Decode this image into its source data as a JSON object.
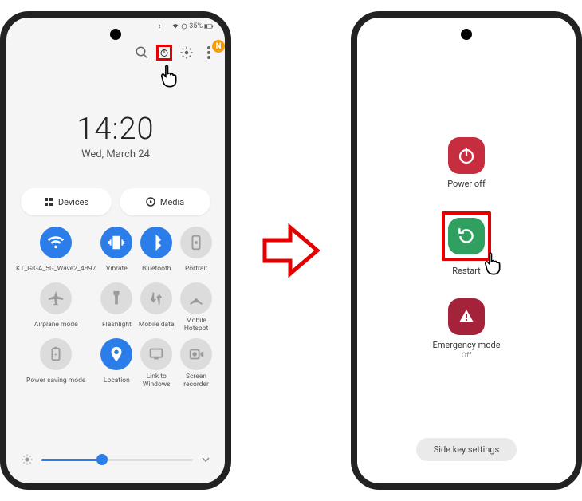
{
  "status": {
    "battery": "35%",
    "icons": "✱ ✕"
  },
  "clock": {
    "time": "14:20",
    "date": "Wed, March 24"
  },
  "dm": {
    "devices": "Devices",
    "media": "Media"
  },
  "qs": [
    {
      "label": "KT_GiGA_5G_Wave2_4B97",
      "on": true,
      "icon": "wifi"
    },
    {
      "label": "Vibrate",
      "on": true,
      "icon": "vibrate"
    },
    {
      "label": "Bluetooth",
      "on": true,
      "icon": "bluetooth"
    },
    {
      "label": "Portrait",
      "on": false,
      "icon": "portrait"
    },
    {
      "label": "Airplane mode",
      "on": false,
      "icon": "airplane"
    },
    {
      "label": "Flashlight",
      "on": false,
      "icon": "flashlight"
    },
    {
      "label": "Mobile data",
      "on": false,
      "icon": "mobiledata"
    },
    {
      "label": "Mobile Hotspot",
      "on": false,
      "icon": "hotspot"
    },
    {
      "label": "Power saving mode",
      "on": false,
      "icon": "powersave"
    },
    {
      "label": "Location",
      "on": true,
      "icon": "location"
    },
    {
      "label": "Link to Windows",
      "on": false,
      "icon": "link"
    },
    {
      "label": "Screen recorder",
      "on": false,
      "icon": "recorder"
    }
  ],
  "brightness": {
    "percent": 40
  },
  "power": {
    "poweroff": "Power off",
    "restart": "Restart",
    "emergency": "Emergency mode",
    "emergency_sub": "Off",
    "sidekey": "Side key settings"
  }
}
